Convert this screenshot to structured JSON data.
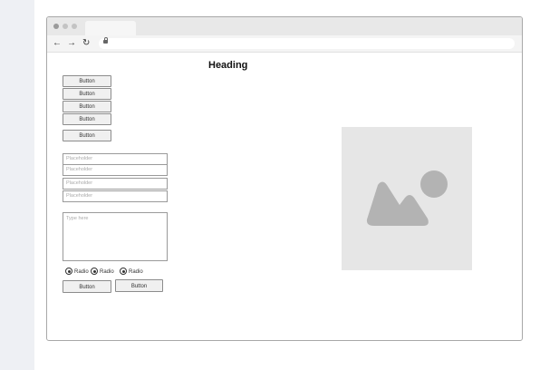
{
  "heading": "Heading",
  "buttons": {
    "stack": [
      "Button",
      "Button",
      "Button",
      "Button"
    ],
    "single": "Button",
    "bottom_left": "Button",
    "bottom_right": "Button"
  },
  "fields": [
    "Placeholder",
    "Placeholder",
    "Placeholder",
    "Placeholder"
  ],
  "textarea_placeholder": "Type here",
  "radios": [
    "Radio",
    "Radio",
    "Radio"
  ],
  "icons": {
    "back": "back-arrow-icon",
    "forward": "forward-arrow-icon",
    "reload": "reload-icon",
    "lock": "lock-icon",
    "image": "image-placeholder-icon"
  },
  "colors": {
    "image_bg": "#e6e6e6",
    "image_fg": "#b3b3b3"
  }
}
